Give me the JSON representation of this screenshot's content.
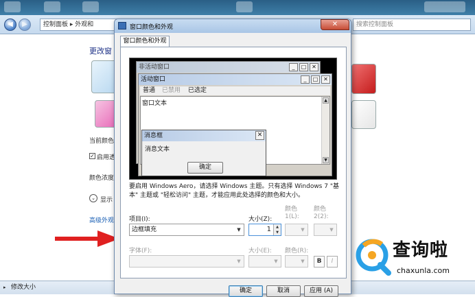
{
  "explorer": {
    "address": "控制面板 ▸ 外观和",
    "search_placeholder": "搜索控制面板",
    "heading": "更改窗",
    "current_color_label": "当前颜色",
    "enable_transparency": "启用透",
    "color_intensity": "颜色浓度",
    "show_mixer": "显示",
    "advanced_link": "高级外观",
    "status_text": "修改大小"
  },
  "dialog": {
    "title": "窗口颜色和外观",
    "close_label": "✕",
    "tab_label": "窗口颜色和外观",
    "preview": {
      "inactive_window_title": "非活动窗口",
      "active_window_title": "活动窗口",
      "menu_items": [
        "普通",
        "已禁用",
        "已选定"
      ],
      "window_text": "窗口文本",
      "msgbox_title": "消息框",
      "msgbox_text": "消息文本",
      "msgbox_ok": "确定"
    },
    "description": "要启用 Windows Aero，请选择 Windows 主题。只有选择 Windows 7 \"基本\" 主题或 \"轻松访问\" 主题，才能应用此处选择的颜色和大小。",
    "item_label": "项目(I):",
    "item_value": "边框填充",
    "size_label": "大小(Z):",
    "size_value": "1",
    "color1_label": "颜色 1(L):",
    "color2_label": "颜色 2(2):",
    "font_label": "字体(F):",
    "font_size_label": "大小(E):",
    "font_color_label": "颜色(R):",
    "bold_label": "B",
    "italic_label": "I",
    "ok_label": "确定",
    "cancel_label": "取消",
    "apply_label": "应用 (A)"
  },
  "watermark": {
    "cn": "查询啦",
    "en": "chaxunla.com"
  },
  "colors": {
    "arrow": "#e02020",
    "watermark_blue": "#2aa0e6",
    "watermark_orange": "#f5a623"
  }
}
